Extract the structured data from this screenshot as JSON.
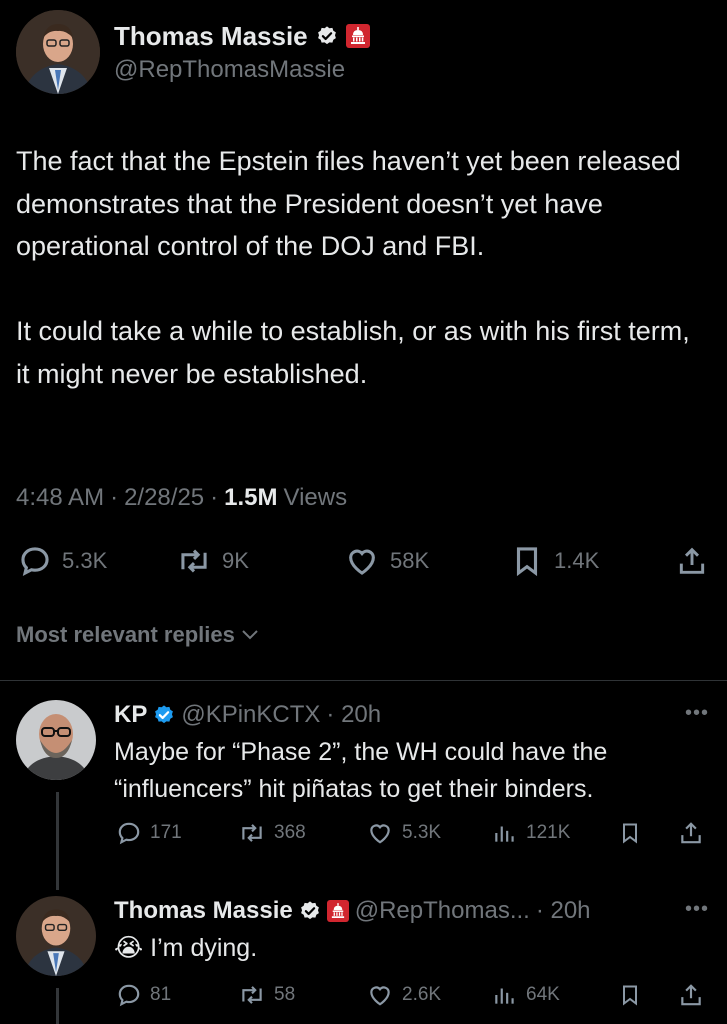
{
  "main_tweet": {
    "author_name": "Thomas Massie",
    "handle": "@RepThomasMassie",
    "verified_icon": "verified-badge-icon",
    "gov_icon": "capitol-badge-icon",
    "text": "The fact that the Epstein files haven’t yet been released demonstrates that the President doesn’t yet have operational control of the DOJ and FBI.\n\nIt could take a while to establish, or as with his first term, it might never be established.",
    "time": "4:48 AM",
    "date": "2/28/25",
    "views_count": "1.5M",
    "views_label": "Views",
    "separator": "·",
    "stats": {
      "replies": "5.3K",
      "reposts": "9K",
      "likes": "58K",
      "bookmarks": "1.4K"
    }
  },
  "replies_section": {
    "label": "Most relevant replies"
  },
  "replies": [
    {
      "name": "KP",
      "handle": "@KPinKCTX",
      "time": "· 20h",
      "text": "Maybe for “Phase 2”, the WH could have the “influencers” hit piñatas to get their binders.",
      "stats": {
        "replies": "171",
        "reposts": "368",
        "likes": "5.3K",
        "views": "121K"
      }
    },
    {
      "name": "Thomas Massie",
      "handle": "@RepThomas...",
      "time": "· 20h",
      "emoji": "😭",
      "text": "I’m dying.",
      "stats": {
        "replies": "81",
        "reposts": "58",
        "likes": "2.6K",
        "views": "64K"
      }
    }
  ],
  "colors": {
    "background": "#000000",
    "text": "#e7e9ea",
    "muted": "#71767b",
    "verified": "#1d9bf0",
    "gov_badge": "#d1262f"
  }
}
